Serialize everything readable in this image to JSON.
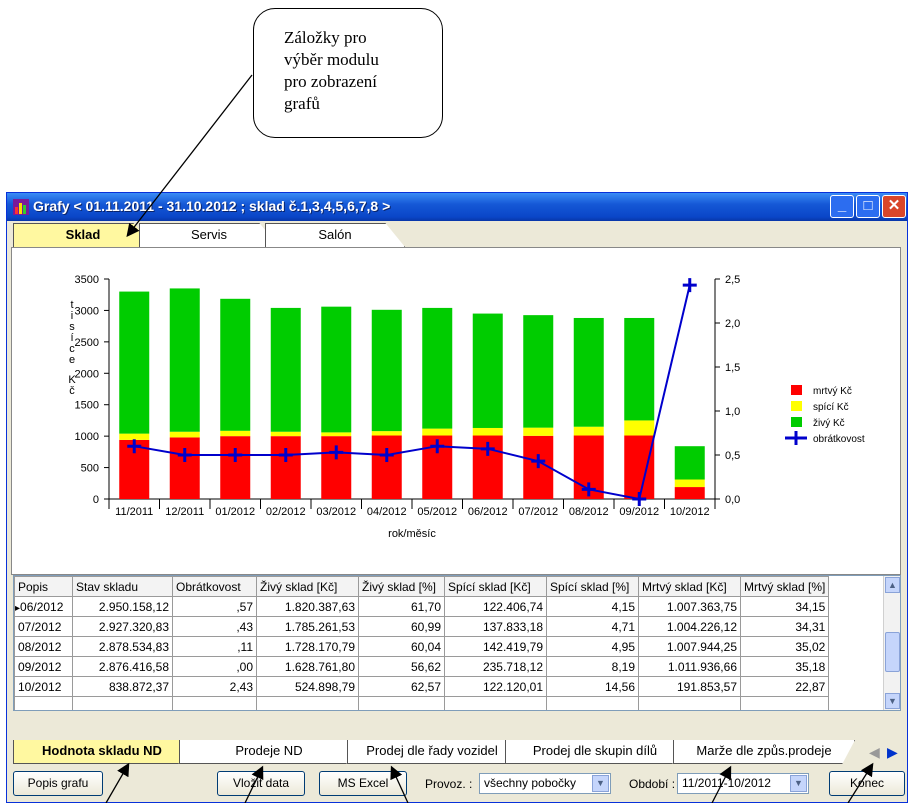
{
  "callout": {
    "line1": "Záložky pro",
    "line2": "výběr modulu",
    "line3": "pro zobrazení",
    "line4": "grafů"
  },
  "window": {
    "title": "Grafy < 01.11.2011 - 31.10.2012 ; sklad č.1,3,4,5,6,7,8 >"
  },
  "top_tabs": [
    {
      "label": "Sklad",
      "active": true
    },
    {
      "label": "Servis"
    },
    {
      "label": "Salón"
    }
  ],
  "chart_data": {
    "type": "bar",
    "categories": [
      "11/2011",
      "12/2011",
      "01/2012",
      "02/2012",
      "03/2012",
      "04/2012",
      "05/2012",
      "06/2012",
      "07/2012",
      "08/2012",
      "09/2012",
      "10/2012"
    ],
    "series": [
      {
        "name": "mrtvý Kč",
        "color": "#ff0000",
        "values": [
          940,
          980,
          1000,
          1000,
          1000,
          1010,
          1010,
          1010,
          1005,
          1010,
          1010,
          190
        ]
      },
      {
        "name": "spící Kč",
        "color": "#ffff00",
        "values": [
          100,
          90,
          85,
          70,
          60,
          70,
          110,
          120,
          130,
          140,
          240,
          120
        ]
      },
      {
        "name": "živý Kč",
        "color": "#00cc00",
        "values": [
          2260,
          2280,
          2100,
          1970,
          2000,
          1930,
          1920,
          1820,
          1790,
          1730,
          1630,
          530
        ]
      },
      {
        "name": "obrátkovost",
        "color": "#0000cc",
        "type": "line",
        "axis": "right",
        "values": [
          0.6,
          0.5,
          0.5,
          0.5,
          0.53,
          0.5,
          0.6,
          0.57,
          0.43,
          0.11,
          0.0,
          2.43
        ]
      }
    ],
    "ylim": [
      0,
      3500
    ],
    "y2lim": [
      0,
      2.5
    ],
    "yticks": [
      "0",
      "500",
      "1000",
      "1500",
      "2000",
      "2500",
      "3000",
      "3500"
    ],
    "y2ticks": [
      "0,0",
      "0,5",
      "1,0",
      "1,5",
      "2,0",
      "2,5"
    ],
    "ylabel": "tisíce Kč",
    "xlabel": "rok/měsíc",
    "legend_position": "right"
  },
  "grid": {
    "columns": [
      "Popis",
      "Stav skladu",
      "Obrátkovost",
      "Živý sklad [Kč]",
      "Živý sklad [%]",
      "Spící sklad [Kč]",
      "Spící sklad [%]",
      "Mrtvý sklad [Kč]",
      "Mrtvý sklad [%]"
    ],
    "rows": [
      [
        "06/2012",
        "2.950.158,12",
        ",57",
        "1.820.387,63",
        "61,70",
        "122.406,74",
        "4,15",
        "1.007.363,75",
        "34,15"
      ],
      [
        "07/2012",
        "2.927.320,83",
        ",43",
        "1.785.261,53",
        "60,99",
        "137.833,18",
        "4,71",
        "1.004.226,12",
        "34,31"
      ],
      [
        "08/2012",
        "2.878.534,83",
        ",11",
        "1.728.170,79",
        "60,04",
        "142.419,79",
        "4,95",
        "1.007.944,25",
        "35,02"
      ],
      [
        "09/2012",
        "2.876.416,58",
        ",00",
        "1.628.761,80",
        "56,62",
        "235.718,12",
        "8,19",
        "1.011.936,66",
        "35,18"
      ],
      [
        "10/2012",
        "838.872,37",
        "2,43",
        "524.898,79",
        "62,57",
        "122.120,01",
        "14,56",
        "191.853,57",
        "22,87"
      ]
    ]
  },
  "bottom_tabs": [
    {
      "label": "Hodnota skladu ND",
      "active": true
    },
    {
      "label": "Prodeje ND"
    },
    {
      "label": "Prodej dle řady vozidel"
    },
    {
      "label": "Prodej dle skupin dílů"
    },
    {
      "label": "Marže dle způs.prodeje"
    }
  ],
  "buttons": {
    "popis": "Popis grafu",
    "vlozit": "Vložit data",
    "excel": "MS Excel",
    "konec": "Konec"
  },
  "filters": {
    "provoz_label": "Provoz. :",
    "provoz_value": "všechny pobočky",
    "obdobi_label": "Období :",
    "obdobi_value": "11/2011-10/2012"
  },
  "colors": {
    "titlebar": "#0a46c8",
    "active_tab": "#fff8a0"
  }
}
